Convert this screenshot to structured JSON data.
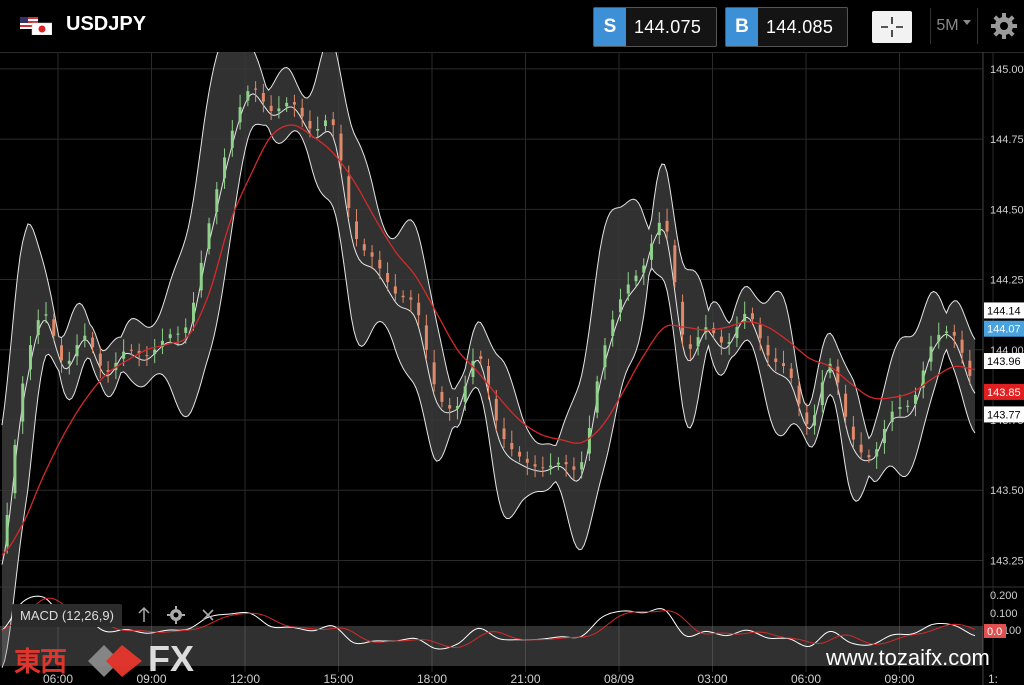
{
  "header": {
    "symbol": "USDJPY",
    "sell_label": "S",
    "sell_price": "144.075",
    "buy_label": "B",
    "buy_price": "144.085",
    "timeframe": "5M",
    "icons": [
      "us-japan-flag-icon",
      "crosshair-icon",
      "dropdown-arrow-icon",
      "gear-icon"
    ]
  },
  "price_axis": {
    "ticks": [
      "145.00",
      "144.75",
      "144.50",
      "144.25",
      "144.00",
      "143.75",
      "143.50",
      "143.25"
    ],
    "markers": [
      {
        "label": "144.14",
        "value": 144.14,
        "bg": "#ffffff",
        "fg": "#000000"
      },
      {
        "label": "144.07",
        "value": 144.075,
        "bg": "#4aa3df",
        "fg": "#ffffff"
      },
      {
        "label": "143.96",
        "value": 143.96,
        "bg": "#ffffff",
        "fg": "#000000"
      },
      {
        "label": "143.85",
        "value": 143.85,
        "bg": "#e02020",
        "fg": "#ffffff"
      },
      {
        "label": "143.77",
        "value": 143.77,
        "bg": "#ffffff",
        "fg": "#000000"
      }
    ]
  },
  "time_axis": [
    "06:00",
    "09:00",
    "12:00",
    "15:00",
    "18:00",
    "21:00",
    "08/09",
    "03:00",
    "06:00",
    "09:00",
    "1:"
  ],
  "macd": {
    "label": "MACD (12,26,9)",
    "ticks": [
      "0.200",
      "0.100",
      "-0.100"
    ],
    "marker": "0.0"
  },
  "watermark": {
    "kanji": "東西",
    "fx": "FX",
    "website": "www.tozaifx.com"
  },
  "colors": {
    "accent_blue": "#3d8fd6",
    "ma_red": "#d42a2a",
    "band_fill": "#3a3a3a",
    "candle_green": "#8fd08a",
    "candle_red": "#e08a6a"
  },
  "chart_data": {
    "type": "line",
    "ylim": [
      143.12,
      145.06
    ],
    "x_ticks": [
      "06:00",
      "09:00",
      "12:00",
      "15:00",
      "18:00",
      "21:00",
      "08/09",
      "03:00",
      "06:00",
      "09:00",
      "1:"
    ],
    "series": [
      {
        "values": [
          143.3,
          143.88,
          144.13,
          143.95,
          144.05,
          143.92,
          144.0,
          143.98,
          144.05,
          144.1,
          144.45,
          144.75,
          144.93,
          144.85,
          144.88,
          144.78,
          144.8,
          144.42,
          144.32,
          144.2,
          144.15,
          143.85,
          143.8,
          143.98,
          143.72,
          143.62,
          143.58,
          143.6,
          143.6,
          143.98,
          144.2,
          144.3,
          144.45,
          144.02,
          144.08,
          144.02,
          144.13,
          143.98,
          143.92,
          143.73,
          143.95,
          143.7,
          143.62,
          143.78,
          143.82,
          144.03,
          144.05,
          143.87
        ]
      },
      {
        "values": [
          143.27,
          143.38,
          143.55,
          143.7,
          143.82,
          143.91,
          143.96,
          144.0,
          144.02,
          144.05,
          144.2,
          144.45,
          144.62,
          144.76,
          144.8,
          144.76,
          144.7,
          144.6,
          144.47,
          144.35,
          144.26,
          144.13,
          144.0,
          143.92,
          143.83,
          143.75,
          143.7,
          143.68,
          143.67,
          143.73,
          143.85,
          143.98,
          144.08,
          144.08,
          144.07,
          144.08,
          144.1,
          144.08,
          144.03,
          143.97,
          143.94,
          143.88,
          143.83,
          143.83,
          143.85,
          143.9,
          143.94,
          143.93
        ]
      }
    ],
    "grid": true
  }
}
